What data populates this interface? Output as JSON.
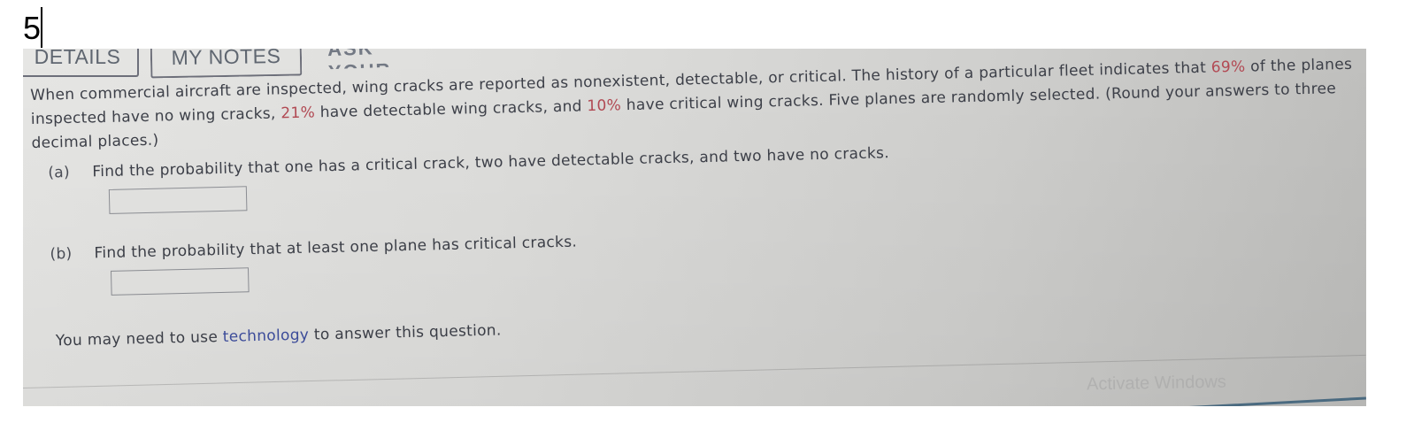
{
  "overlay": {
    "question_number": "5"
  },
  "tabs": {
    "details": "DETAILS",
    "my_notes": "MY NOTES",
    "partial_tab": "ASK YOUR TEACHER"
  },
  "question": {
    "intro_1": "When commercial aircraft are inspected, wing cracks are reported as nonexistent, detectable, or critical. The history of a particular fleet indicates that ",
    "pct_none": "69%",
    "intro_2": " of the planes inspected have no wing cracks, ",
    "pct_detectable": "21%",
    "intro_3": " have detectable wing cracks, and ",
    "pct_critical": "10%",
    "intro_4": " have critical wing cracks. Five planes are randomly selected. (Round your answers to three decimal places.)",
    "parts": [
      {
        "label": "(a)",
        "text": "Find the probability that one has a critical crack, two have detectable cracks, and two have no cracks.",
        "answer": ""
      },
      {
        "label": "(b)",
        "text": "Find the probability that at least one plane has critical cracks.",
        "answer": ""
      }
    ],
    "note_1": "You may need to use ",
    "note_link": "technology",
    "note_2": " to answer this question."
  },
  "system": {
    "watermark": "Activate Windows"
  },
  "colors": {
    "highlight_red": "#b24a54",
    "link_blue": "#3d4d9e",
    "text": "#3c3f48"
  }
}
